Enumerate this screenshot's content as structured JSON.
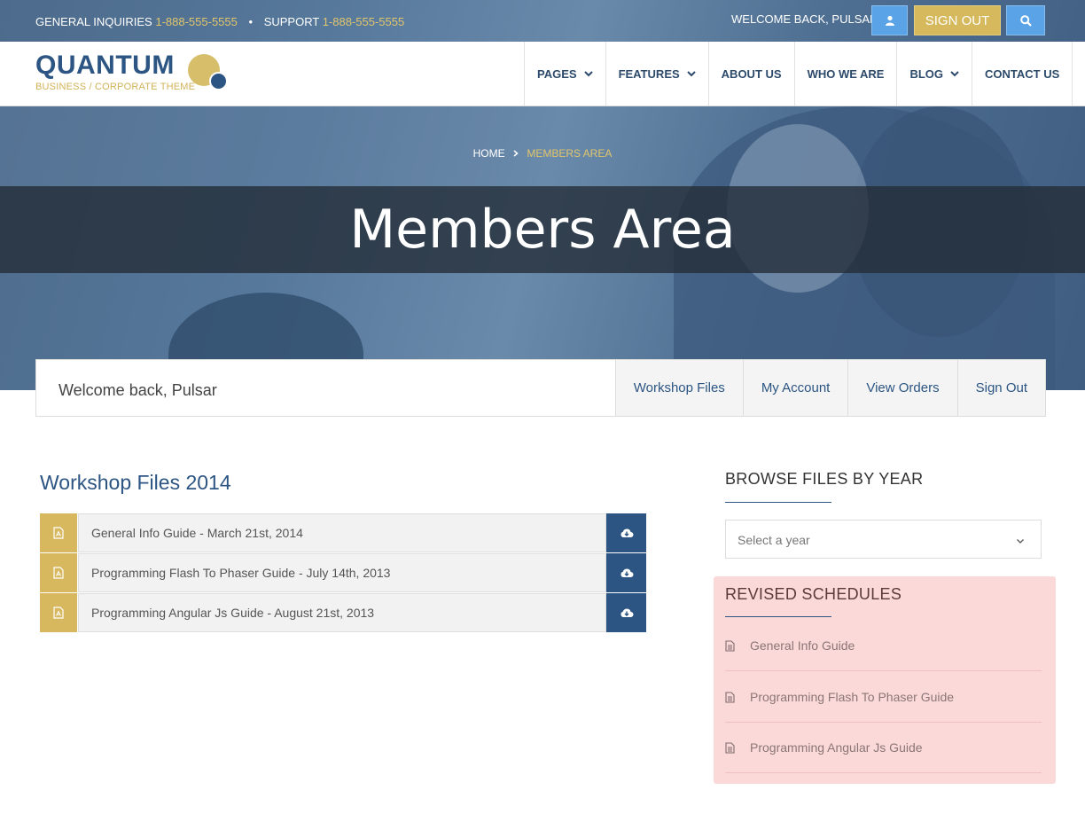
{
  "topbar": {
    "general_label": "GENERAL INQUIRIES",
    "general_phone": "1-888-555-5555",
    "separator": "•",
    "support_label": "SUPPORT",
    "support_phone": "1-888-555-5555",
    "welcome": "WELCOME BACK, PULSAR",
    "sign_out": "SIGN OUT",
    "icons": [
      "user-icon",
      "search-icon"
    ]
  },
  "brand": {
    "name": "QUANTUM",
    "tagline": "BUSINESS / CORPORATE THEME",
    "primary_color": "#2c5583",
    "accent_color": "#d6b95c"
  },
  "nav": {
    "items": [
      {
        "label": "PAGES",
        "dropdown": true
      },
      {
        "label": "FEATURES",
        "dropdown": true
      },
      {
        "label": "ABOUT US",
        "dropdown": false
      },
      {
        "label": "WHO WE ARE",
        "dropdown": false
      },
      {
        "label": "BLOG",
        "dropdown": true
      },
      {
        "label": "CONTACT US",
        "dropdown": false
      }
    ]
  },
  "hero": {
    "breadcrumb_home": "HOME",
    "breadcrumb_current": "MEMBERS AREA",
    "title": "Members Area"
  },
  "member_bar": {
    "greeting": "Welcome back, Pulsar",
    "links": [
      "Workshop Files",
      "My Account",
      "View Orders",
      "Sign Out"
    ]
  },
  "files": {
    "title": "Workshop Files 2014",
    "rows": [
      {
        "name": "General Info Guide - March 21st, 2014"
      },
      {
        "name": "Programming Flash To Phaser Guide - July 14th, 2013"
      },
      {
        "name": "Programming Angular Js Guide - August 21st, 2013"
      }
    ]
  },
  "sidebar": {
    "browse_title": "BROWSE FILES BY YEAR",
    "select_placeholder": "Select a year",
    "revised_title": "REVISED SCHEDULES",
    "revised_items": [
      "General Info Guide",
      "Programming Flash To Phaser Guide",
      "Programming Angular Js Guide"
    ],
    "revised_bg": "#fcd9d9"
  }
}
